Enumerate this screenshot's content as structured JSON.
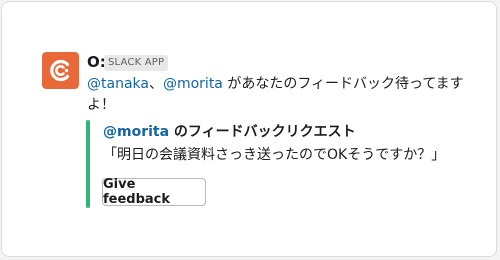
{
  "message": {
    "sender": "O:",
    "app_badge": "SLACK APP",
    "avatar_icon": "app-logo-icon",
    "mention_1": "@tanaka",
    "separator": "、",
    "mention_2": "@morita",
    "text": " があなたのフィードバック待ってますよ！"
  },
  "attachment": {
    "accent_color": "#2eb67d",
    "title_mention": "@morita",
    "title_suffix": " のフィードバックリクエスト",
    "body": "「明日の会議資料さっき送ったのでOKそうですか？」",
    "button_label": "Give feedback"
  },
  "colors": {
    "avatar_bg": "#e8683a",
    "mention": "#1264a3"
  }
}
